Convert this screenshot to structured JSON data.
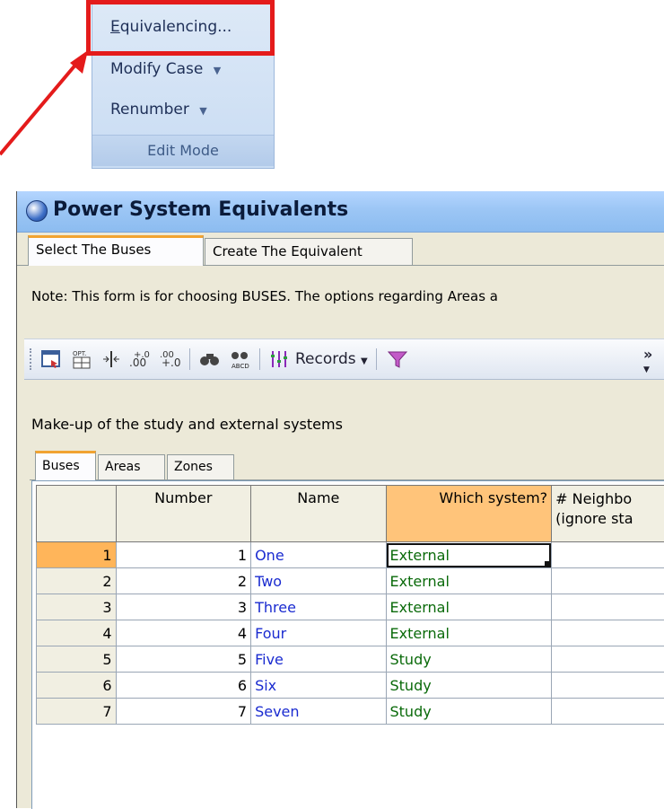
{
  "ribbon": {
    "items": [
      {
        "label_first": "E",
        "label_rest": "quivalencing...",
        "has_dropdown": false
      },
      {
        "label": "Modify Case",
        "has_dropdown": true
      },
      {
        "label": "Renumber",
        "has_dropdown": true
      }
    ],
    "group_caption": "Edit Mode",
    "dropdown_glyph": "▼",
    "highlight_color": "#e41b1b"
  },
  "window": {
    "title": "Power System Equivalents",
    "tabs": [
      {
        "label": "Select The Buses",
        "active": true
      },
      {
        "label": "Create The Equivalent",
        "active": false
      }
    ],
    "note": "Note: This form is for choosing BUSES.  The options regarding Areas a",
    "toolbar": {
      "records_label": "Records",
      "overflow_glyph": "»",
      "icons": [
        "select-icon",
        "options-icon",
        "freeze-column-icon",
        "increase-decimals-icon",
        "decrease-decimals-icon",
        "find-icon",
        "find-abcd-icon",
        "columns-icon",
        "records-dropdown",
        "filter-icon",
        "overflow-icon"
      ]
    },
    "section_label": "Make-up of the study and external systems",
    "subtabs": [
      {
        "label": "Buses",
        "active": true
      },
      {
        "label": "Areas",
        "active": false
      },
      {
        "label": "Zones",
        "active": false
      }
    ],
    "grid": {
      "columns": [
        "Number",
        "Name",
        "Which system?",
        "# Neighbo"
      ],
      "column_subtitle": "(ignore sta",
      "rows": [
        {
          "row": "1",
          "number": "1",
          "name": "One",
          "system": "External"
        },
        {
          "row": "2",
          "number": "2",
          "name": "Two",
          "system": "External"
        },
        {
          "row": "3",
          "number": "3",
          "name": "Three",
          "system": "External"
        },
        {
          "row": "4",
          "number": "4",
          "name": "Four",
          "system": "External"
        },
        {
          "row": "5",
          "number": "5",
          "name": "Five",
          "system": "Study"
        },
        {
          "row": "6",
          "number": "6",
          "name": "Six",
          "system": "Study"
        },
        {
          "row": "7",
          "number": "7",
          "name": "Seven",
          "system": "Study"
        }
      ]
    }
  }
}
